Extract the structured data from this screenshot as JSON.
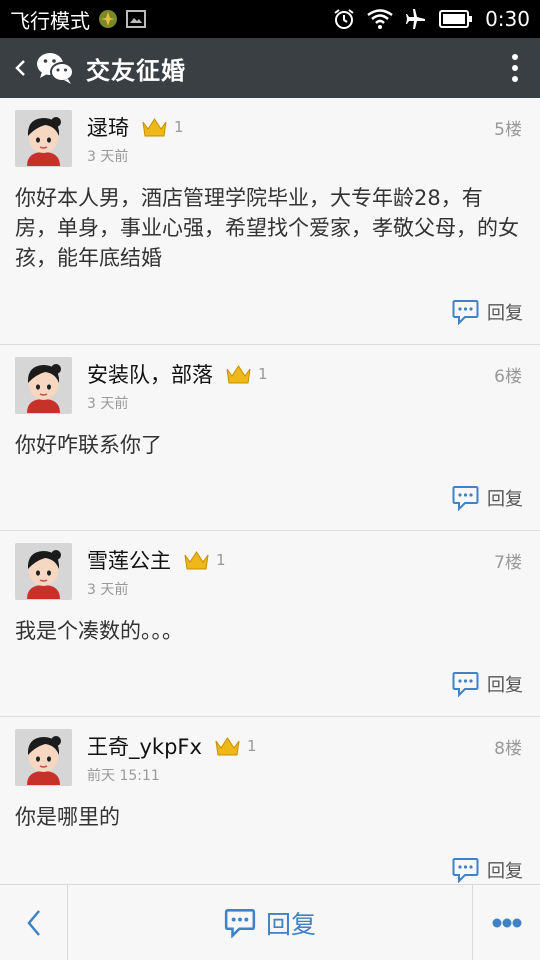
{
  "status": {
    "left_text": "飞行模式",
    "time": "0:30"
  },
  "header": {
    "title": "交友征婚"
  },
  "posts": [
    {
      "username": "逯琦",
      "level": "1",
      "time": "3 天前",
      "floor": "5楼",
      "body": "你好本人男，酒店管理学院毕业，大专年龄28，有房，单身，事业心强，希望找个爱家，孝敬父母，的女孩，能年底结婚",
      "reply_label": "回复"
    },
    {
      "username": "安装队，部落",
      "level": "1",
      "time": "3 天前",
      "floor": "6楼",
      "body": "你好咋联系你了",
      "reply_label": "回复"
    },
    {
      "username": "雪莲公主",
      "level": "1",
      "time": "3 天前",
      "floor": "7楼",
      "body": "我是个凑数的。。。",
      "reply_label": "回复"
    },
    {
      "username": "王奇_ykpFx",
      "level": "1",
      "time": "前天 15:11",
      "floor": "8楼",
      "body": "你是哪里的",
      "reply_label": "回复"
    }
  ],
  "bottom": {
    "reply_label": "回复"
  },
  "colors": {
    "accent": "#3f82c8",
    "appbar": "#3a3f44",
    "crown": "#f0b719"
  }
}
